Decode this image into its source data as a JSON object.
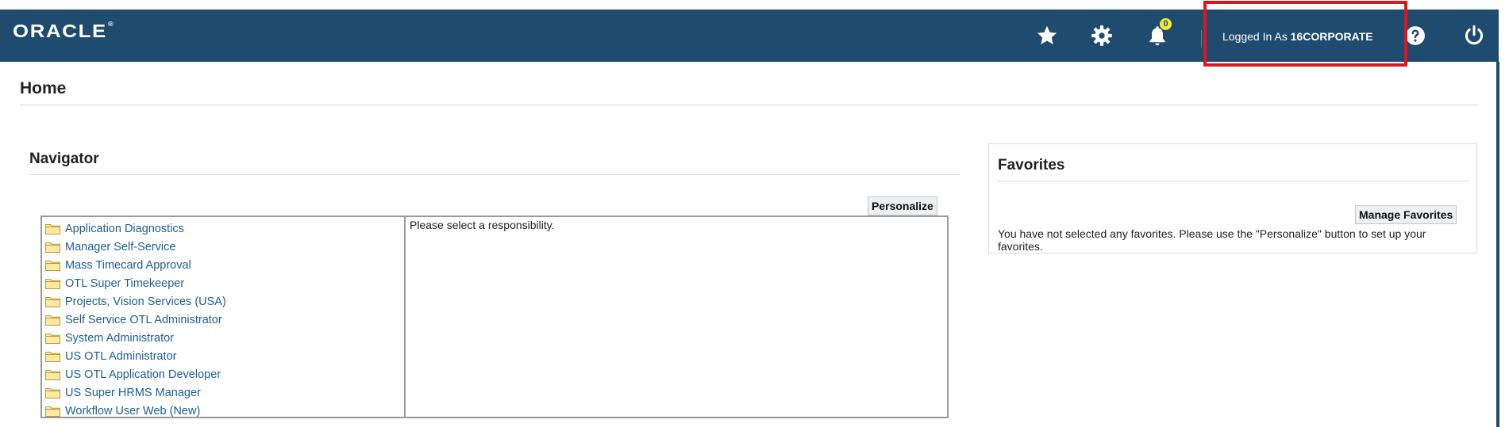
{
  "header": {
    "logo": "ORACLE",
    "logo_mark": "®",
    "notification_count": "0",
    "login_prefix": "Logged In As ",
    "login_user": "16CORPORATE",
    "icons": [
      "star-icon",
      "gear-icon",
      "bell-icon",
      "help-icon",
      "power-icon"
    ]
  },
  "page": {
    "title": "Home"
  },
  "navigator": {
    "title": "Navigator",
    "personalize_label": "Personalize",
    "responsibilities": [
      "Application Diagnostics",
      "Manager Self-Service",
      "Mass Timecard Approval",
      "OTL Super Timekeeper",
      "Projects, Vision Services (USA)",
      "Self Service OTL Administrator",
      "System Administrator",
      "US OTL Administrator",
      "US OTL Application Developer",
      "US Super HRMS Manager",
      "Workflow User Web (New)"
    ],
    "detail_message": "Please select a responsibility."
  },
  "favorites": {
    "title": "Favorites",
    "manage_label": "Manage Favorites",
    "message": "You have not selected any favorites. Please use the \"Personalize\" button to set up your favorites."
  },
  "colors": {
    "header_bg": "#1f4b6e",
    "link": "#1f5e93",
    "badge": "#f3e73a",
    "highlight": "#e0141e"
  }
}
